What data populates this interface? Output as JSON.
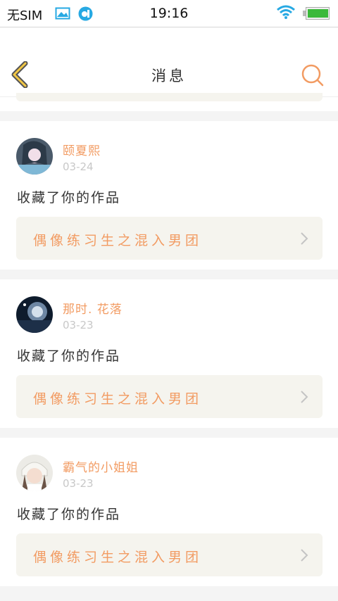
{
  "status_bar": {
    "carrier": "无SIM",
    "time": "19:16"
  },
  "header": {
    "title": "消息"
  },
  "notifications": [
    {
      "username": "颐夏熙",
      "date": "03-24",
      "action": "收藏了你的作品",
      "work_title": "偶像练习生之混入男团"
    },
    {
      "username": "那时. 花落",
      "date": "03-23",
      "action": "收藏了你的作品",
      "work_title": "偶像练习生之混入男团"
    },
    {
      "username": "霸气的小姐姐",
      "date": "03-23",
      "action": "收藏了你的作品",
      "work_title": "偶像练习生之混入男团"
    }
  ],
  "colors": {
    "accent": "#f29b62",
    "back_arrow": "#f2c744",
    "date": "#c8c8c8",
    "work_box": "#f5f4ee",
    "battery": "#3bb93b",
    "wifi": "#27a9e3"
  }
}
